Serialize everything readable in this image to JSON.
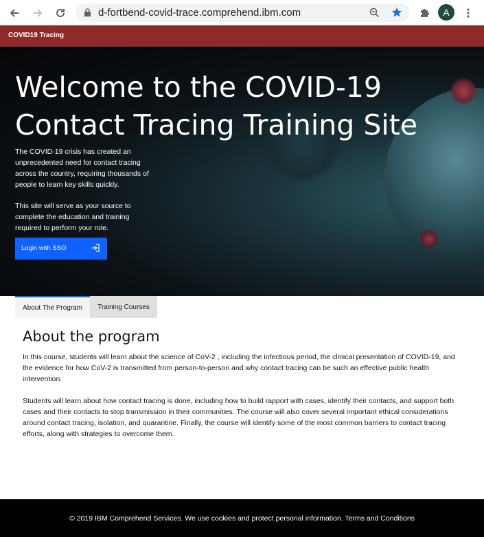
{
  "browser": {
    "url": "d-fortbend-covid-trace.comprehend.ibm.com",
    "profile_initial": "A",
    "back_icon": "arrow-left-icon",
    "forward_icon": "arrow-right-icon",
    "reload_icon": "reload-icon",
    "lock_icon": "lock-icon",
    "zoom_icon": "magnifier-icon",
    "star_icon": "star-icon",
    "extensions_icon": "puzzle-icon",
    "menu_icon": "kebab-menu-icon",
    "accent_color": "#1a73e8"
  },
  "app_bar": {
    "title": "COVID19 Tracing",
    "color": "#8f2a2a"
  },
  "hero": {
    "title": "Welcome to the COVID-19 Contact Tracing Training Site",
    "paragraph_1": "The COVID-19 crisis has created an unprecedented need for contact tracing across the country, requiring thousands of people to learn key skills quickly.",
    "paragraph_2": "This site will serve as your source to complete the education and training required to perform your role.",
    "login_button": "Login with SSO",
    "login_icon": "login-arrow-icon",
    "button_color": "#0f62fe"
  },
  "tabs": [
    {
      "label": "About The Program",
      "active": true
    },
    {
      "label": "Training Courses",
      "active": false
    }
  ],
  "content": {
    "heading": "About the program",
    "paragraph_1": "In this course, students will learn about the science of CoV-2 , including the infectious period, the clinical presentation of COVID-19, and the evidence for how CoV-2 is transmitted from person-to-person and why contact tracing can be such an effective public health intervention.",
    "paragraph_2": "Students will learn about how contact tracing is done, including how to build rapport with cases, identify their contacts, and support both cases and their contacts to stop transmission in their communities. The course will also cover several important ethical considerations around contact tracing, isolation, and quarantine. Finally, the course will identify some of the most common barriers to contact tracing efforts, along with strategies to overcome them."
  },
  "footer": {
    "text": "© 2019 IBM Comprehend Services. We use cookies and protect personal information. Terms and Conditions"
  }
}
